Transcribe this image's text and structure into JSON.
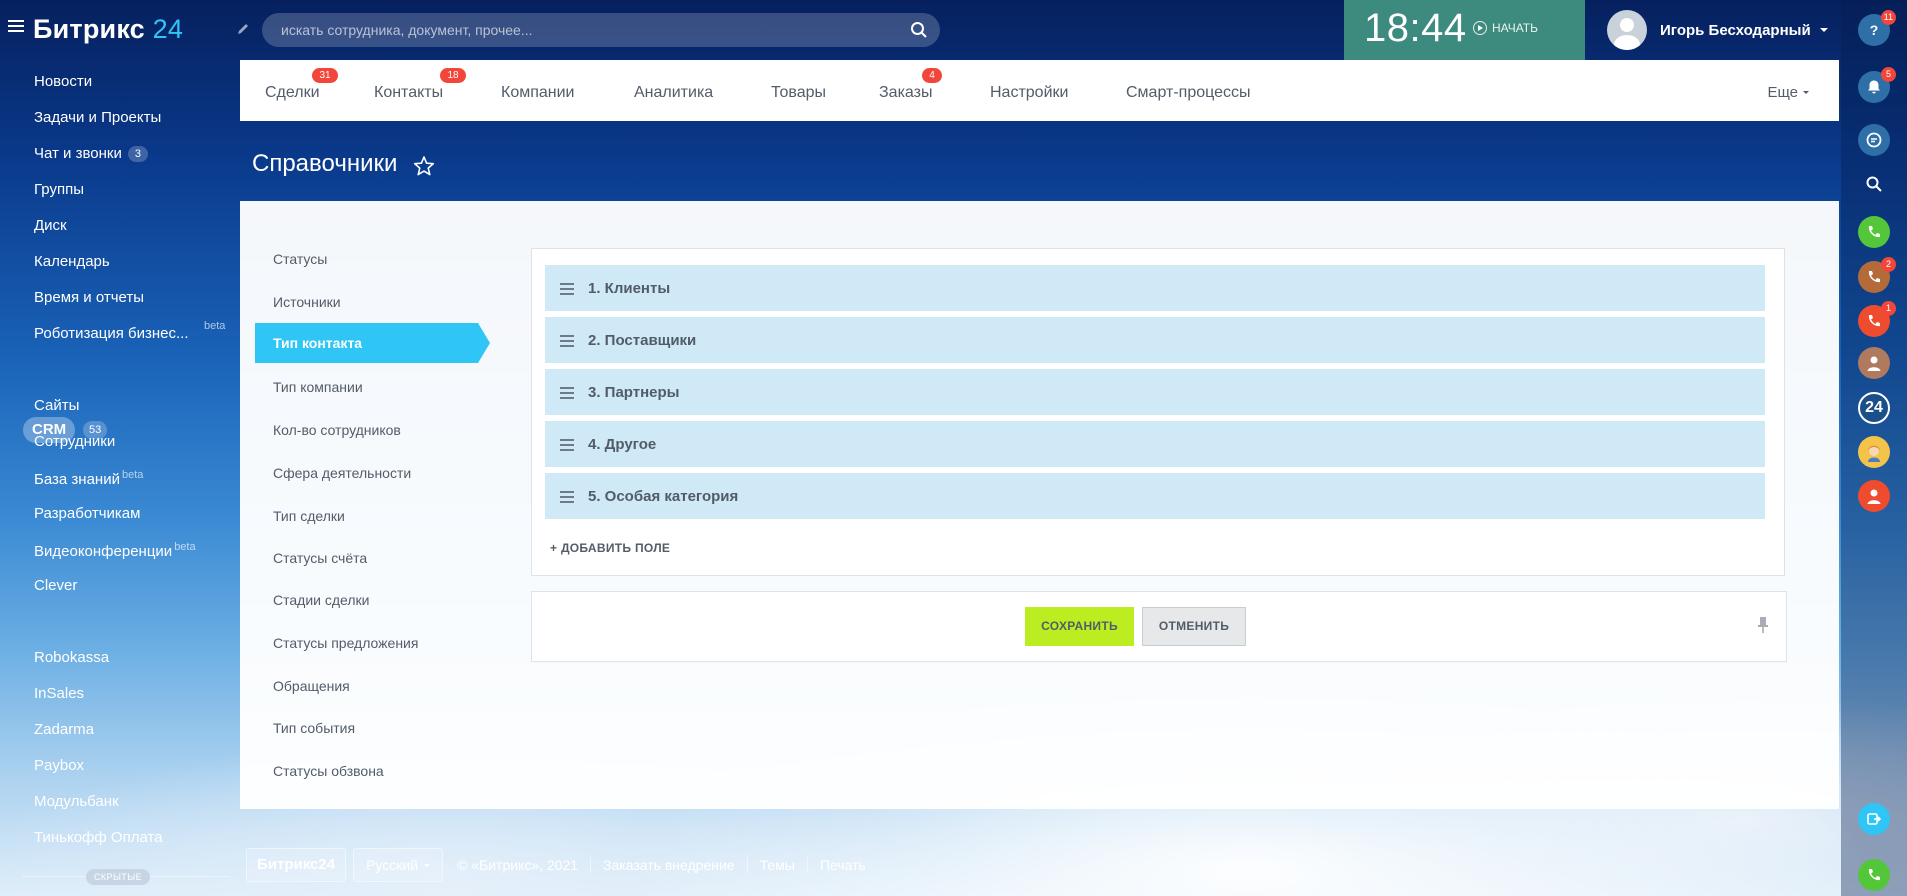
{
  "header": {
    "logo_main": "Битрикс",
    "logo_num": "24",
    "search_placeholder": "искать сотрудника, документ, прочее...",
    "time": "18:44",
    "start_label": "НАЧАТЬ",
    "user_name": "Игорь Бесходарный"
  },
  "sidebar": {
    "items": [
      {
        "label": "Новости"
      },
      {
        "label": "Задачи и Проекты"
      },
      {
        "label": "Чат и звонки",
        "count": "3"
      },
      {
        "label": "Группы"
      },
      {
        "label": "Диск"
      },
      {
        "label": "Календарь"
      },
      {
        "label": "Время и отчеты"
      },
      {
        "label": "Роботизация бизнес...",
        "beta": "beta"
      },
      {
        "label": "CRM",
        "count": "53"
      },
      {
        "label": "Сайты"
      },
      {
        "label": "Сотрудники"
      },
      {
        "label": "База знаний",
        "beta": "beta"
      },
      {
        "label": "Разработчикам"
      },
      {
        "label": "Видеоконференции",
        "beta": "beta"
      },
      {
        "label": "Clever"
      },
      {
        "label": "Robokassa"
      },
      {
        "label": "InSales"
      },
      {
        "label": "Zadarma"
      },
      {
        "label": "Paybox"
      },
      {
        "label": "Модульбанк"
      },
      {
        "label": "Тинькофф Оплата"
      }
    ],
    "hidden_label": "СКРЫТЫЕ"
  },
  "topnav": {
    "items": [
      {
        "label": "Сделки",
        "count": "31"
      },
      {
        "label": "Контакты",
        "count": "18"
      },
      {
        "label": "Компании"
      },
      {
        "label": "Аналитика"
      },
      {
        "label": "Товары"
      },
      {
        "label": "Заказы",
        "count": "4"
      },
      {
        "label": "Настройки"
      },
      {
        "label": "Смарт-процессы"
      }
    ],
    "more": "Еще"
  },
  "page": {
    "title": "Справочники"
  },
  "submenu": {
    "items": [
      "Статусы",
      "Источники",
      "Тип контакта",
      "Тип компании",
      "Кол-во сотрудников",
      "Сфера деятельности",
      "Тип сделки",
      "Статусы счёта",
      "Стадии сделки",
      "Статусы предложения",
      "Обращения",
      "Тип события",
      "Статусы обзвона"
    ],
    "active_index": 2
  },
  "list": {
    "rows": [
      "1. Клиенты",
      "2. Поставщики",
      "3. Партнеры",
      "4. Другое",
      "5. Особая категория"
    ],
    "add_field": "+ ДОБАВИТЬ ПОЛЕ"
  },
  "buttons": {
    "save": "СОХРАНИТЬ",
    "cancel": "ОТМЕНИТЬ"
  },
  "rail": {
    "help_badge": "11",
    "notifications_badge": "5",
    "call2_badge": "2",
    "call3_badge": "1",
    "b24_label": "24"
  },
  "footer": {
    "logo": "Битрикс24",
    "language": "Русский",
    "copyright": "© «Битрикс», 2021",
    "order": "Заказать внедрение",
    "themes": "Темы",
    "print": "Печать"
  },
  "colors": {
    "accent": "#2fc6f6",
    "save_button": "#bbed21",
    "badge": "#f2463a",
    "row_bg": "#cfe9f7",
    "clock_bg": "#3d8a7e"
  }
}
